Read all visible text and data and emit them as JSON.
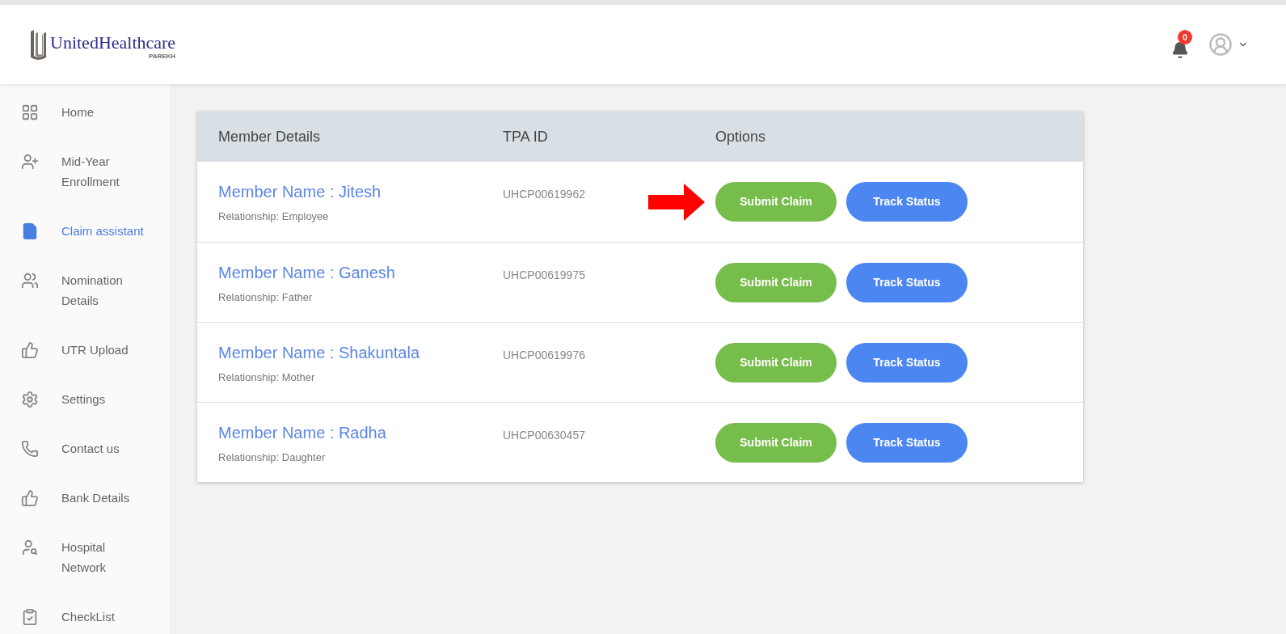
{
  "header": {
    "logo_text": "UnitedHealthcare",
    "logo_subtext": "PAREKH",
    "notification_count": "0"
  },
  "sidebar": {
    "items": [
      {
        "label": "Home",
        "selected": false
      },
      {
        "label": "Mid-Year Enrollment",
        "selected": false
      },
      {
        "label": "Claim assistant",
        "selected": true
      },
      {
        "label": "Nomination Details",
        "selected": false
      },
      {
        "label": "UTR Upload",
        "selected": false
      },
      {
        "label": "Settings",
        "selected": false
      },
      {
        "label": "Contact us",
        "selected": false
      },
      {
        "label": "Bank Details",
        "selected": false
      },
      {
        "label": "Hospital Network",
        "selected": false
      },
      {
        "label": "CheckList",
        "selected": false
      }
    ]
  },
  "table": {
    "columns": [
      "Member Details",
      "TPA ID",
      "Options"
    ],
    "rows": [
      {
        "name": "Member Name : Jitesh",
        "relationship": "Relationship: Employee",
        "tpa_id": "UHCP00619962",
        "buttons": [
          "Submit Claim",
          "Track Status"
        ],
        "pointed": true
      },
      {
        "name": "Member Name : Ganesh",
        "relationship": "Relationship: Father",
        "tpa_id": "UHCP00619975",
        "buttons": [
          "Submit Claim",
          "Track Status"
        ],
        "pointed": false
      },
      {
        "name": "Member Name : Shakuntala",
        "relationship": "Relationship: Mother",
        "tpa_id": "UHCP00619976",
        "buttons": [
          "Submit Claim",
          "Track Status"
        ],
        "pointed": false
      },
      {
        "name": "Member Name : Radha",
        "relationship": "Relationship: Daughter",
        "tpa_id": "UHCP00630457",
        "buttons": [
          "Submit Claim",
          "Track Status"
        ],
        "pointed": false
      }
    ]
  }
}
